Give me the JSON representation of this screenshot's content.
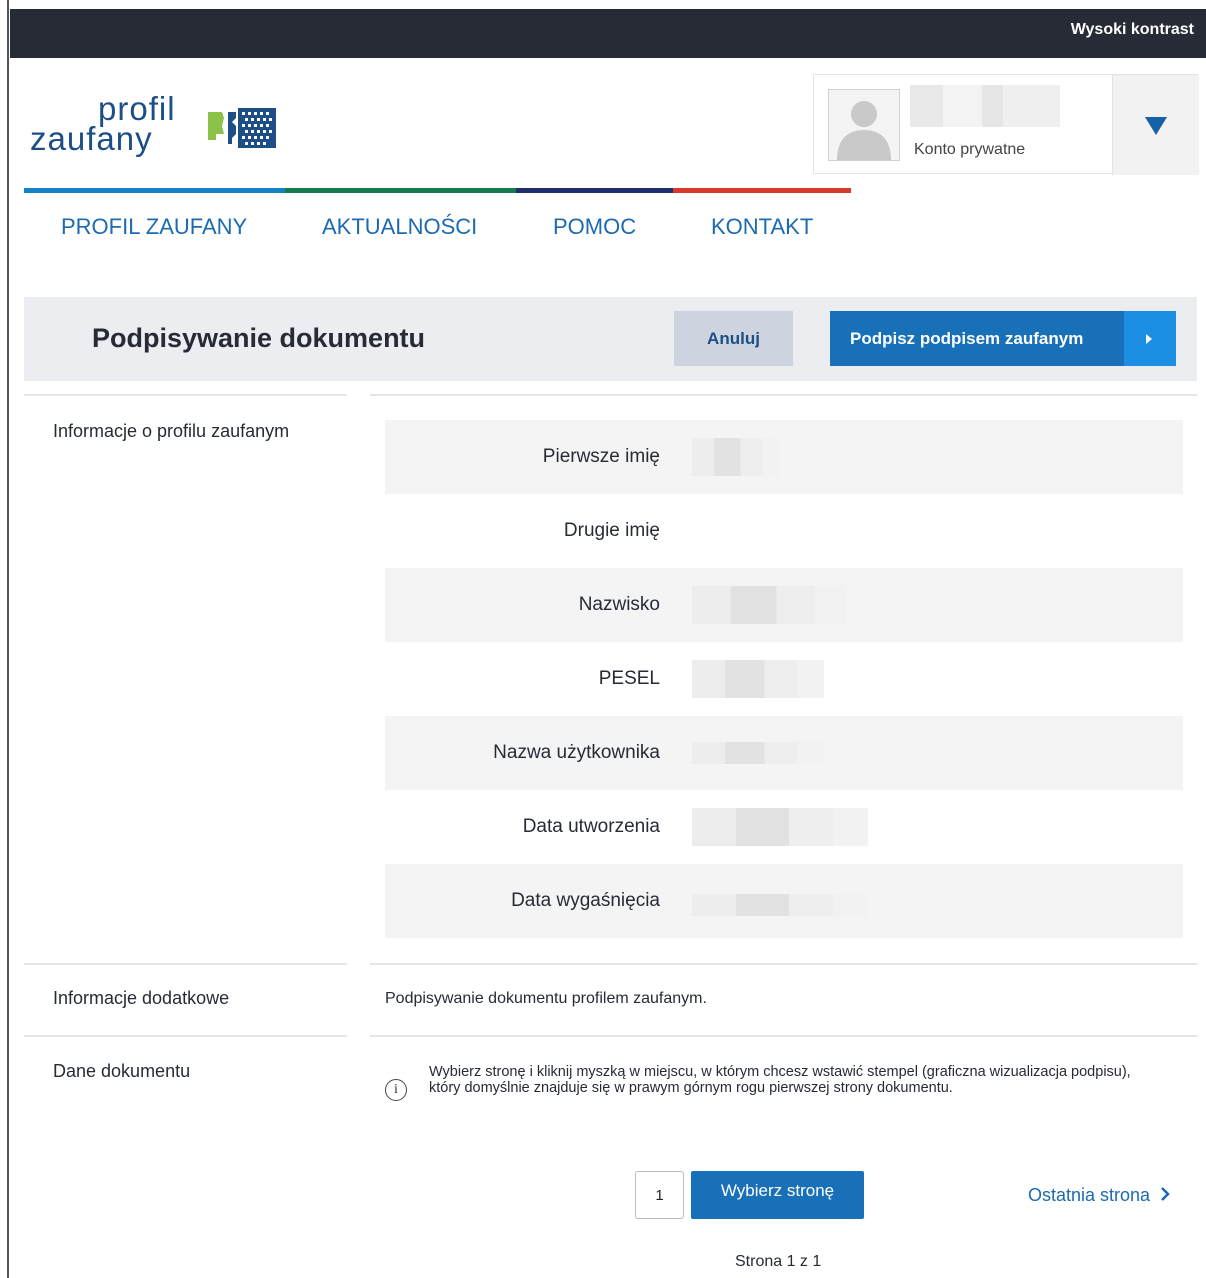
{
  "topbar": {
    "high_contrast_label": "Wysoki kontrast"
  },
  "logo": {
    "line1": "profil",
    "line2": "zaufany"
  },
  "user": {
    "account_type": "Konto prywatne"
  },
  "nav": {
    "items": [
      "PROFIL ZAUFANY",
      "AKTUALNOŚCI",
      "POMOC",
      "KONTAKT"
    ]
  },
  "titlebar": {
    "title": "Podpisywanie dokumentu",
    "cancel_label": "Anuluj",
    "sign_label": "Podpisz podpisem zaufanym"
  },
  "profile_section": {
    "label": "Informacje o profilu zaufanym",
    "rows": [
      {
        "key": "Pierwsze imię"
      },
      {
        "key": "Drugie imię"
      },
      {
        "key": "Nazwisko"
      },
      {
        "key": "PESEL"
      },
      {
        "key": "Nazwa użytkownika"
      },
      {
        "key": "Data utworzenia"
      },
      {
        "key": "Data wygaśnięcia"
      }
    ]
  },
  "extra_section": {
    "label": "Informacje dodatkowe",
    "text": "Podpisywanie dokumentu profilem zaufanym."
  },
  "document_section": {
    "label": "Dane dokumentu",
    "hint": "Wybierz stronę i kliknij myszką w miejscu, w którym chcesz wstawić stempel (graficzna wizualizacja podpisu), który domyślnie znajduje się w prawym górnym rogu pierwszej strony dokumentu.",
    "page_value": "1",
    "choose_page_label": "Wybierz stronę",
    "last_page_label": "Ostatnia strona",
    "pager_status": "Strona 1 z 1"
  },
  "colors": {
    "primary": "#1770b8",
    "dark": "#262b36",
    "link": "#1c6bb0"
  }
}
